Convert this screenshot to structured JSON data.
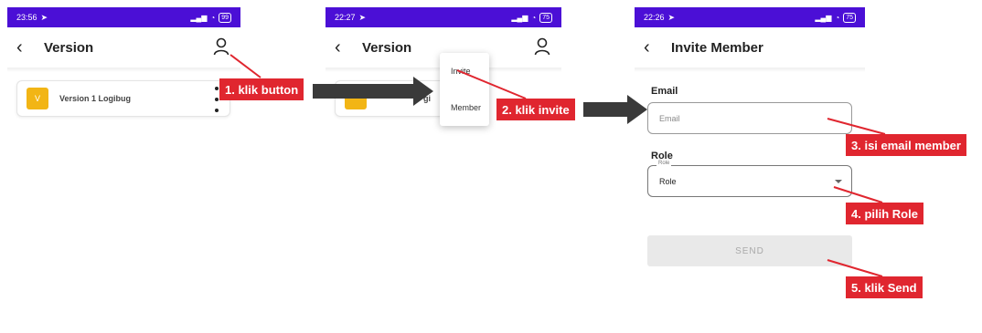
{
  "screen1": {
    "status_time": "23:56",
    "battery": "99",
    "title": "Version",
    "card": {
      "badge": "V",
      "name": "Version 1 Logibug"
    }
  },
  "screen2": {
    "status_time": "22:27",
    "battery": "75",
    "title": "Version",
    "menu": [
      "Invite",
      "Member"
    ],
    "card_fragment": "gi"
  },
  "screen3": {
    "status_time": "22:26",
    "battery": "75",
    "title": "Invite Member",
    "email_label": "Email",
    "email_placeholder": "Email",
    "role_label": "Role",
    "role_legend": "Role",
    "role_value": "Role",
    "send_label": "SEND"
  },
  "callouts": {
    "step1": "1. klik button",
    "step2": "2. klik invite",
    "step3": "3. isi email member",
    "step4": "4. pilih Role",
    "step5": "5. klik Send"
  },
  "colors": {
    "statusbar": "#4b0fd6",
    "callout": "#e0262f",
    "badge": "#f2b515",
    "arrow": "#3a3a3a"
  },
  "icons": [
    "back-arrow-icon",
    "user-icon",
    "more-vert-icon",
    "dropdown-caret-icon",
    "signal-icon",
    "wifi-icon",
    "battery-icon"
  ]
}
